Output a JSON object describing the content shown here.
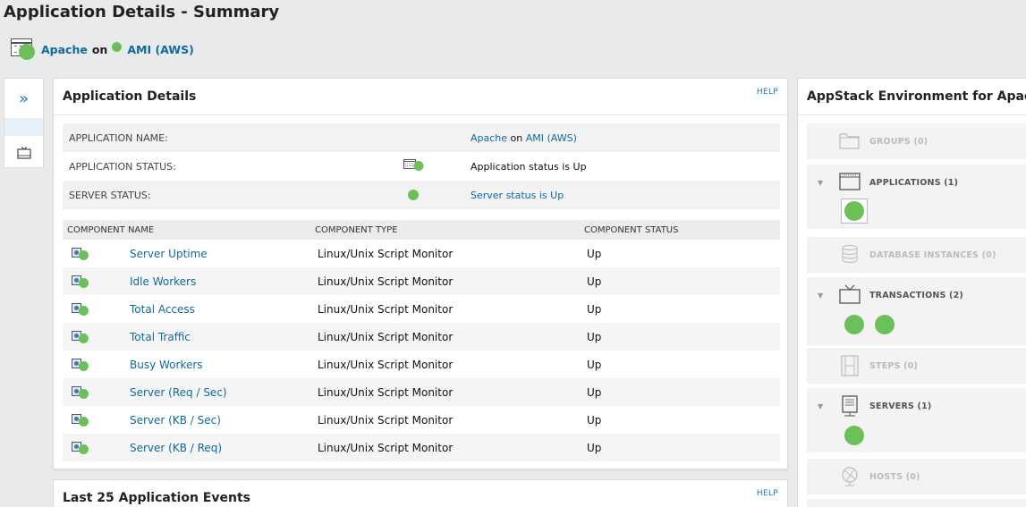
{
  "page": {
    "title": "Application Details - Summary"
  },
  "subheader": {
    "app_name": "Apache",
    "on": "on",
    "node_name": "AMI (AWS)"
  },
  "main": {
    "title": "Application Details",
    "help": "HELP",
    "details": {
      "app_name_label": "APPLICATION NAME:",
      "app_name_value": "Apache",
      "app_name_on": "on",
      "app_name_node": "AMI (AWS)",
      "app_status_label": "APPLICATION STATUS:",
      "app_status_value": "Application status is Up",
      "server_status_label": "SERVER STATUS:",
      "server_status_value": "Server status is Up"
    },
    "components": {
      "headers": [
        "COMPONENT NAME",
        "COMPONENT TYPE",
        "COMPONENT STATUS"
      ],
      "rows": [
        {
          "name": "Server Uptime",
          "type": "Linux/Unix Script Monitor",
          "status": "Up"
        },
        {
          "name": "Idle Workers",
          "type": "Linux/Unix Script Monitor",
          "status": "Up"
        },
        {
          "name": "Total Access",
          "type": "Linux/Unix Script Monitor",
          "status": "Up"
        },
        {
          "name": "Total Traffic",
          "type": "Linux/Unix Script Monitor",
          "status": "Up"
        },
        {
          "name": "Busy Workers",
          "type": "Linux/Unix Script Monitor",
          "status": "Up"
        },
        {
          "name": "Server (Req / Sec)",
          "type": "Linux/Unix Script Monitor",
          "status": "Up"
        },
        {
          "name": "Server (KB / Sec)",
          "type": "Linux/Unix Script Monitor",
          "status": "Up"
        },
        {
          "name": "Server (KB / Req)",
          "type": "Linux/Unix Script Monitor",
          "status": "Up"
        }
      ]
    }
  },
  "events": {
    "title": "Last 25 Application Events",
    "help": "HELP"
  },
  "appstack": {
    "title": "AppStack Environment for Apache",
    "sections": {
      "groups": "GROUPS (0)",
      "applications": "APPLICATIONS (1)",
      "database_instances": "DATABASE INSTANCES (0)",
      "transactions": "TRANSACTIONS (2)",
      "steps": "STEPS (0)",
      "servers": "SERVERS (1)",
      "hosts": "HOSTS (0)"
    }
  },
  "colors": {
    "status_up": "#6cc05a",
    "link": "#0f6a9e",
    "accent": "#1a78b0"
  },
  "icons": {
    "nav_expand": "double-chevron-right-icon",
    "nav_transactions": "tv-icon",
    "groups": "folder-icon",
    "applications": "application-window-icon",
    "database_instances": "database-icon",
    "transactions": "tv-icon",
    "steps": "film-strip-icon",
    "servers": "server-icon",
    "hosts": "globe-host-icon",
    "component": "component-monitor-icon",
    "status": "status-up-dot-icon"
  }
}
